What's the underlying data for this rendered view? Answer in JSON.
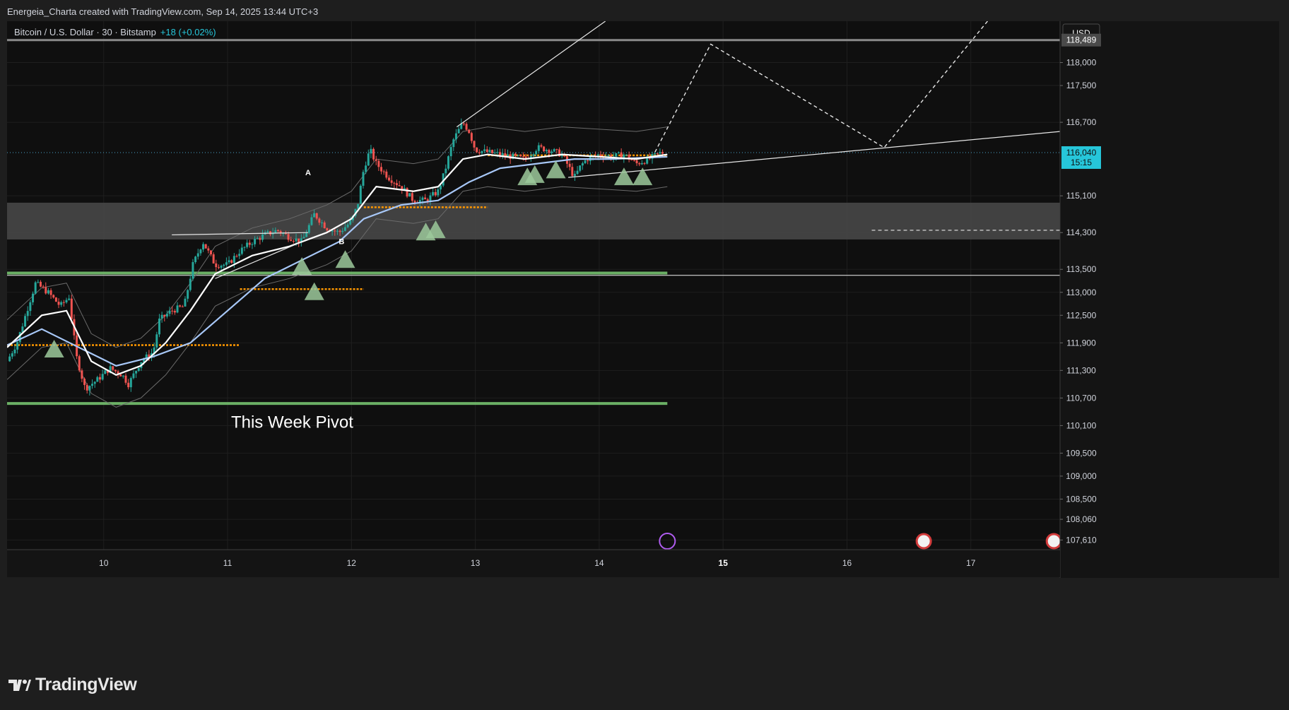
{
  "header": {
    "caption": "Energeia_Charta created with TradingView.com, Sep 14, 2025 13:44 UTC+3"
  },
  "footer": {
    "logo_text": "TradingView"
  },
  "colors": {
    "background": "#0f0f0f",
    "up": "#26a69a",
    "down": "#ef5350",
    "ema_white": "#ffffff",
    "ema_blue": "#a8c8f8",
    "band": "#6a6a6a",
    "zone": "#4a4a4a",
    "green_line": "#76c26f",
    "orange": "#ff9800",
    "triangle": "#9cc99b",
    "price_badge": "#26c6da",
    "axis_text": "#d1d4dc"
  },
  "chart_data": {
    "type": "candlestick",
    "symbol": "Bitcoin / U.S. Dollar · 30 · Bitstamp",
    "change": "+18 (+0.02%)",
    "currency": "USD",
    "x_ticks": [
      {
        "label": "10",
        "day": 10
      },
      {
        "label": "11",
        "day": 11
      },
      {
        "label": "12",
        "day": 12
      },
      {
        "label": "13",
        "day": 13
      },
      {
        "label": "14",
        "day": 14
      },
      {
        "label": "15",
        "day": 15,
        "bold": true
      },
      {
        "label": "16",
        "day": 16
      },
      {
        "label": "17",
        "day": 17
      }
    ],
    "y_ticks": [
      "118,000",
      "117,500",
      "116,700",
      "115,100",
      "114,300",
      "113,500",
      "113,000",
      "112,500",
      "111,900",
      "111,300",
      "110,700",
      "110,100",
      "109,500",
      "109,000",
      "108,500",
      "108,060",
      "107,610"
    ],
    "y_tick_values": [
      118000,
      117500,
      116700,
      115100,
      114300,
      113500,
      113000,
      112500,
      111900,
      111300,
      110700,
      110100,
      109500,
      109000,
      108500,
      108060,
      107610
    ],
    "ylim": [
      107400,
      118900
    ],
    "xlim": [
      9.22,
      17.72
    ],
    "resistance_level": {
      "value": 118489,
      "label": "118,489"
    },
    "last_price": {
      "value": 116040,
      "label": "116,040",
      "countdown": "15:15"
    },
    "pivot_zone": [
      114150,
      114950
    ],
    "support_line": 113370,
    "green_levels": [
      113420,
      110580
    ],
    "orange_levels": [
      {
        "value": 111850,
        "from": 9.22,
        "to": 11.1
      },
      {
        "value": 114850,
        "from": 12.1,
        "to": 13.1
      },
      {
        "value": 113070,
        "from": 11.1,
        "to": 12.1
      },
      {
        "value": 115980,
        "from": 13.1,
        "to": 14.55
      }
    ],
    "price_path": [
      [
        9.22,
        111500
      ],
      [
        9.3,
        111900
      ],
      [
        9.38,
        112600
      ],
      [
        9.45,
        113200
      ],
      [
        9.55,
        113000
      ],
      [
        9.65,
        112700
      ],
      [
        9.72,
        112900
      ],
      [
        9.78,
        111600
      ],
      [
        9.85,
        110900
      ],
      [
        9.95,
        111100
      ],
      [
        10.05,
        111350
      ],
      [
        10.15,
        111200
      ],
      [
        10.2,
        111000
      ],
      [
        10.3,
        111500
      ],
      [
        10.4,
        111700
      ],
      [
        10.45,
        112400
      ],
      [
        10.55,
        112600
      ],
      [
        10.65,
        112700
      ],
      [
        10.72,
        113600
      ],
      [
        10.8,
        114100
      ],
      [
        10.9,
        113600
      ],
      [
        11.0,
        113600
      ],
      [
        11.1,
        113900
      ],
      [
        11.2,
        114100
      ],
      [
        11.3,
        114250
      ],
      [
        11.4,
        114350
      ],
      [
        11.5,
        114200
      ],
      [
        11.6,
        114100
      ],
      [
        11.7,
        114700
      ],
      [
        11.8,
        114400
      ],
      [
        11.9,
        114300
      ],
      [
        12.0,
        114550
      ],
      [
        12.05,
        114900
      ],
      [
        12.1,
        115700
      ],
      [
        12.15,
        116100
      ],
      [
        12.2,
        115800
      ],
      [
        12.3,
        115500
      ],
      [
        12.4,
        115300
      ],
      [
        12.5,
        115000
      ],
      [
        12.6,
        115000
      ],
      [
        12.7,
        115200
      ],
      [
        12.75,
        115600
      ],
      [
        12.82,
        116300
      ],
      [
        12.9,
        116700
      ],
      [
        12.95,
        116500
      ],
      [
        13.0,
        116100
      ],
      [
        13.1,
        116050
      ],
      [
        13.2,
        116000
      ],
      [
        13.3,
        115950
      ],
      [
        13.4,
        115900
      ],
      [
        13.5,
        116150
      ],
      [
        13.6,
        116100
      ],
      [
        13.7,
        116000
      ],
      [
        13.8,
        115500
      ],
      [
        13.85,
        115750
      ],
      [
        13.9,
        115900
      ],
      [
        14.0,
        116000
      ],
      [
        14.1,
        115950
      ],
      [
        14.2,
        116000
      ],
      [
        14.3,
        115800
      ],
      [
        14.4,
        115900
      ],
      [
        14.5,
        116040
      ]
    ],
    "ema_white": [
      [
        9.22,
        111800
      ],
      [
        9.5,
        112500
      ],
      [
        9.7,
        112600
      ],
      [
        9.9,
        111500
      ],
      [
        10.1,
        111200
      ],
      [
        10.3,
        111400
      ],
      [
        10.5,
        111900
      ],
      [
        10.7,
        112600
      ],
      [
        10.9,
        113400
      ],
      [
        11.2,
        113800
      ],
      [
        11.5,
        114000
      ],
      [
        11.8,
        114300
      ],
      [
        12.0,
        114600
      ],
      [
        12.2,
        115300
      ],
      [
        12.5,
        115200
      ],
      [
        12.7,
        115300
      ],
      [
        12.9,
        115900
      ],
      [
        13.1,
        116000
      ],
      [
        13.4,
        115900
      ],
      [
        13.7,
        116000
      ],
      [
        14.0,
        115950
      ],
      [
        14.3,
        115900
      ],
      [
        14.55,
        116000
      ]
    ],
    "ema_blue": [
      [
        9.22,
        111850
      ],
      [
        9.5,
        112200
      ],
      [
        9.8,
        111800
      ],
      [
        10.1,
        111400
      ],
      [
        10.4,
        111600
      ],
      [
        10.7,
        111900
      ],
      [
        11.0,
        112600
      ],
      [
        11.3,
        113300
      ],
      [
        11.6,
        113700
      ],
      [
        11.9,
        114100
      ],
      [
        12.1,
        114600
      ],
      [
        12.4,
        114900
      ],
      [
        12.7,
        115000
      ],
      [
        12.95,
        115400
      ],
      [
        13.2,
        115700
      ],
      [
        13.5,
        115800
      ],
      [
        13.8,
        115900
      ],
      [
        14.1,
        115900
      ],
      [
        14.55,
        115950
      ]
    ],
    "trend_lines": [
      {
        "p1": [
          12.85,
          116600
        ],
        "p2": [
          14.05,
          118900
        ]
      },
      {
        "p1": [
          13.75,
          115500
        ],
        "p2": [
          17.72,
          116500
        ]
      },
      {
        "p1": [
          10.55,
          114250
        ],
        "p2": [
          11.65,
          114300
        ]
      },
      {
        "p1": [
          10.9,
          113300
        ],
        "p2": [
          11.6,
          114100
        ]
      }
    ],
    "projection": [
      [
        14.45,
        116050
      ],
      [
        14.9,
        118400
      ],
      [
        16.3,
        116150
      ],
      [
        17.15,
        118950
      ]
    ],
    "projection_level": {
      "value": 114350,
      "from": 16.2,
      "to": 17.72
    },
    "triangles": [
      [
        9.6,
        111750
      ],
      [
        11.6,
        113550
      ],
      [
        11.7,
        113000
      ],
      [
        11.95,
        113700
      ],
      [
        12.6,
        114300
      ],
      [
        12.68,
        114350
      ],
      [
        13.42,
        115500
      ],
      [
        13.48,
        115550
      ],
      [
        13.65,
        115650
      ],
      [
        14.2,
        115500
      ],
      [
        14.35,
        115500
      ]
    ],
    "point_labels": [
      {
        "text": "A",
        "x": 11.65,
        "y": 115550
      },
      {
        "text": "B",
        "x": 11.92,
        "y": 114050
      }
    ],
    "annotation": {
      "text": "This Week Pivot",
      "x": 11.55,
      "y": 110050
    }
  }
}
